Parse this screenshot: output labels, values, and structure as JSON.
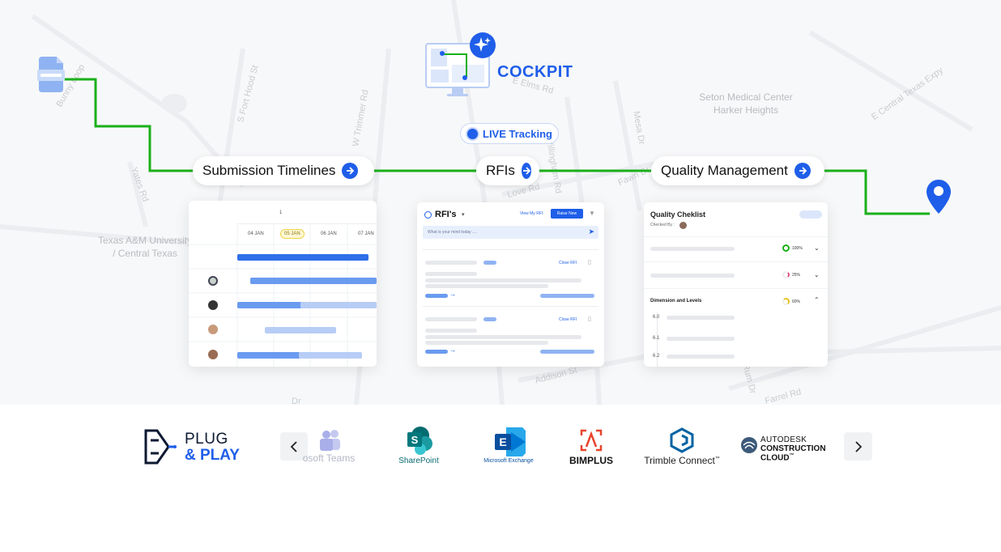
{
  "cockpit": {
    "title": "COCKPIT"
  },
  "live": {
    "label": "LIVE Tracking"
  },
  "map_labels": {
    "streets": [
      "Bunny Loop",
      "S Fort Hood St",
      "W Trimmer Rd",
      "E Elms Rd",
      "Yates Rd",
      "Mesa Dr",
      "Willingham Rd",
      "Love Rd",
      "Fawn Dr",
      "E Central Texas Expy",
      "Addison St",
      "Farrel Rd",
      "Rum Dr",
      "Dr"
    ],
    "places": [
      "Seton Medical Center\nHarker Heights",
      "Texas A&M University\n/ Central Texas"
    ]
  },
  "pills": {
    "submission": "Submission Timelines",
    "rfis": "RFIs",
    "quality": "Quality Management"
  },
  "submission_card": {
    "page": "1",
    "dates": [
      "04 JAN",
      "05 JAN",
      "06 JAN",
      "07 JAN"
    ]
  },
  "rfi_card": {
    "title": "RFI's",
    "view_button": "View My RFI",
    "raise_button": "Raise New",
    "input_placeholder": "What is your mind today ....",
    "close_label_1": "Close RFI",
    "close_label_2": "Close RFI"
  },
  "quality_card": {
    "title": "Quality Cheklist",
    "checked_by": "Checked By :",
    "rows": [
      {
        "pct": "100%"
      },
      {
        "pct": "25%"
      }
    ],
    "section": {
      "label": "Dimension and Levels",
      "pct": "60%"
    },
    "subitems": [
      "6.0",
      "6.1",
      "6.2"
    ]
  },
  "plug": {
    "line1": "PLUG",
    "line2": "& PLAY"
  },
  "integrations": {
    "teams": "osoft Teams",
    "sharepoint": "SharePoint",
    "exchange": "Microsoft Exchange",
    "bimplus": "BIMPLUS",
    "trimble": "Trimble Connect",
    "trimble_tm": "™",
    "autodesk_1": "AUTODESK",
    "autodesk_2": "CONSTRUCTION",
    "autodesk_3": "CLOUD",
    "autodesk_tm": "™",
    "sharepoint_letter": "S",
    "exchange_letter": "E"
  },
  "colors": {
    "route": "#1ab01a",
    "accent": "#1f5ee9",
    "bar_dark": "#2f6fe8",
    "bar_mid": "#6a9bf0",
    "bar_light": "#b7cdf6"
  }
}
